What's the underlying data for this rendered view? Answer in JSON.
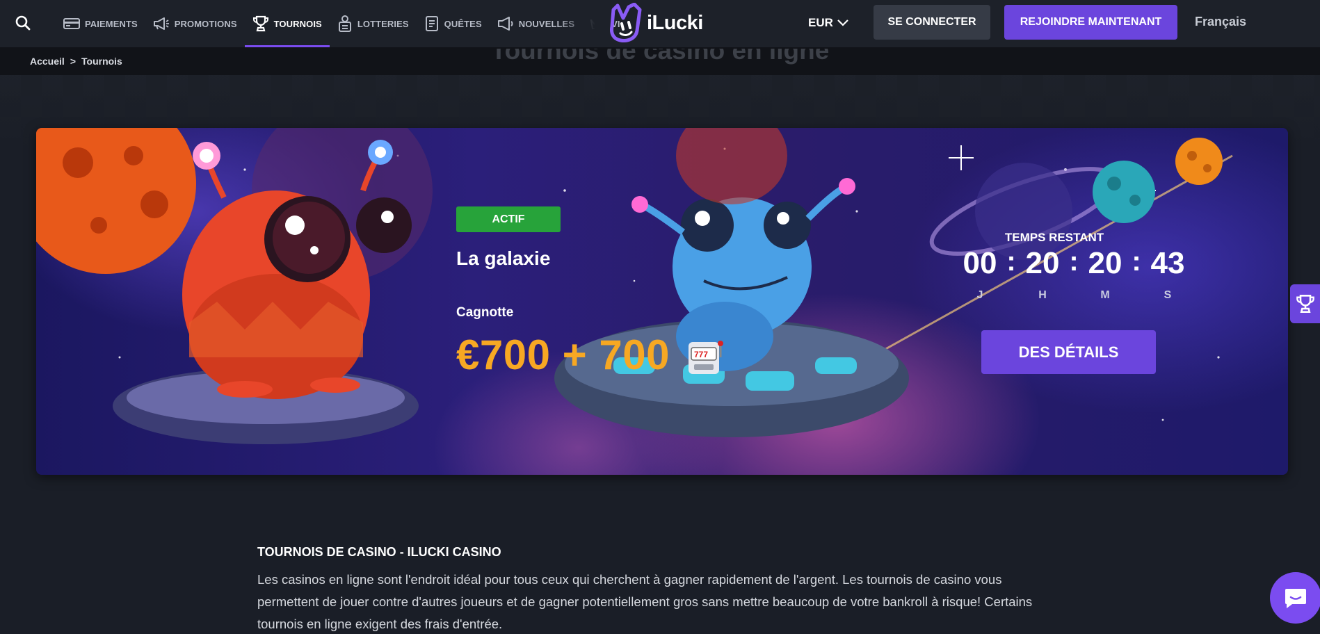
{
  "header": {
    "nav": [
      {
        "label": "PAIEMENTS",
        "icon": "card-icon",
        "active": false
      },
      {
        "label": "PROMOTIONS",
        "icon": "megaphone-icon",
        "active": false
      },
      {
        "label": "TOURNOIS",
        "icon": "trophy-icon",
        "active": true
      },
      {
        "label": "LOTTERIES",
        "icon": "lottery-icon",
        "active": false
      },
      {
        "label": "QUÊTES",
        "icon": "quest-icon",
        "active": false
      },
      {
        "label": "NOUVELLES",
        "icon": "news-icon",
        "active": false
      },
      {
        "label": "VI",
        "icon": "crown-icon",
        "active": false
      }
    ],
    "logo_text": "iLucki",
    "currency": "EUR",
    "login_label": "SE CONNECTER",
    "join_label": "REJOINDRE MAINTENANT",
    "language": "Français"
  },
  "breadcrumb": {
    "home": "Accueil",
    "separator": ">",
    "current": "Tournois"
  },
  "page_title": "Tournois de casino en ligne",
  "tournament": {
    "status": "ACTIF",
    "name": "La galaxie",
    "prize_label": "Cagnotte",
    "prize_value": "€700 + 700",
    "time_label": "TEMPS RESTANT",
    "countdown": {
      "days": "00",
      "hours": "20",
      "minutes": "20",
      "seconds": "43"
    },
    "units": {
      "days": "J",
      "hours": "H",
      "minutes": "M",
      "seconds": "S"
    },
    "details_label": "DES DÉTAILS"
  },
  "article": {
    "heading": "TOURNOIS DE CASINO - ILUCKI CASINO",
    "body": "Les casinos en ligne sont l'endroit idéal pour tous ceux qui cherchent à gagner rapidement de l'argent. Les tournois de casino vous permettent de jouer contre d'autres joueurs et de gagner potentiellement gros sans mettre beaucoup de votre bankroll à risque! Certains tournois en ligne exigent des frais d'entrée."
  },
  "colors": {
    "accent": "#6b45dd",
    "active_badge": "#27a33a",
    "prize": "#f7a823",
    "background": "#1a1e27"
  }
}
